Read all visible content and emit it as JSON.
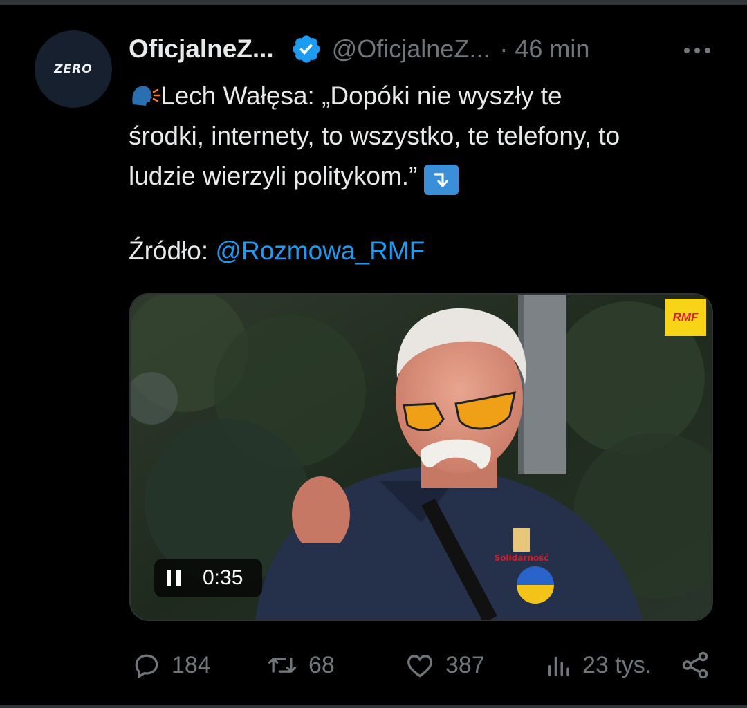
{
  "author": {
    "avatar_text": "ZERO",
    "display_name": "OficjalneZ...",
    "handle": "@OficjalneZ...",
    "separator": "·",
    "time": "46 min"
  },
  "tweet": {
    "line1": "Lech Wałęsa: „Dopóki nie wyszły te",
    "line2": "środki, internety, to wszystko, te telefony, to",
    "line3": "ludzie wierzyli politykom.”",
    "source_label": "Źródło:",
    "source_mention": "@Rozmowa_RMF"
  },
  "media": {
    "badge": "RMF",
    "video_time": "0:35"
  },
  "actions": {
    "replies": "184",
    "reposts": "68",
    "likes": "387",
    "views": "23 tys."
  },
  "colors": {
    "background": "#000000",
    "text": "#e7e9ea",
    "muted": "#71767b",
    "link": "#1d9bf0",
    "verified": "#1d9bf0"
  },
  "icons": [
    "verified-badge-icon",
    "more-icon",
    "speaking-head-emoji",
    "arrow-down-emoji",
    "pause-icon",
    "reply-icon",
    "repost-icon",
    "like-icon",
    "views-icon",
    "share-icon"
  ]
}
